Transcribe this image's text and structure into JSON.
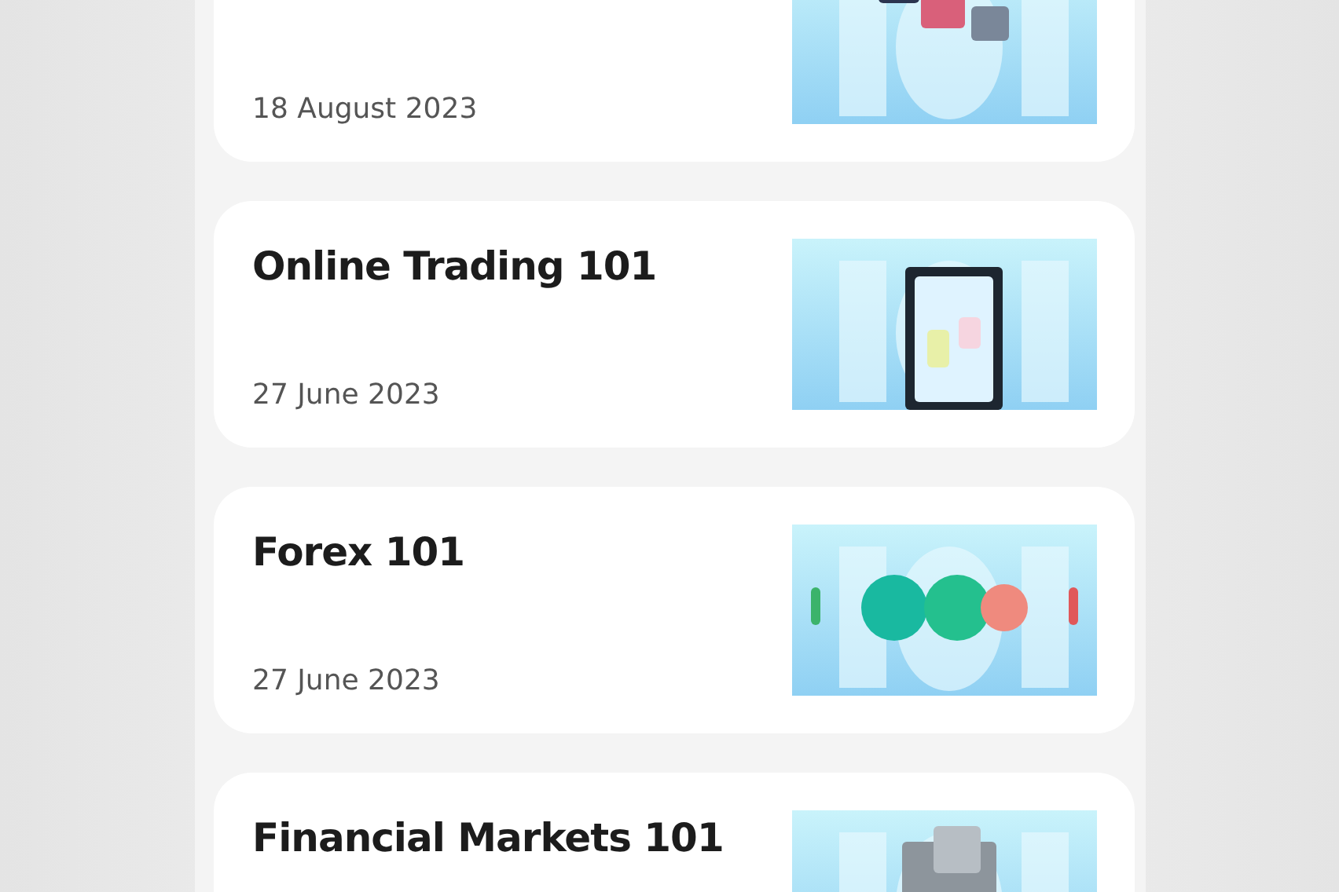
{
  "articles": [
    {
      "date": "18 August 2023"
    },
    {
      "title": "Online Trading 101",
      "date": "27 June 2023"
    },
    {
      "title": "Forex 101",
      "date": "27 June 2023"
    },
    {
      "title": "Financial Markets 101"
    }
  ]
}
